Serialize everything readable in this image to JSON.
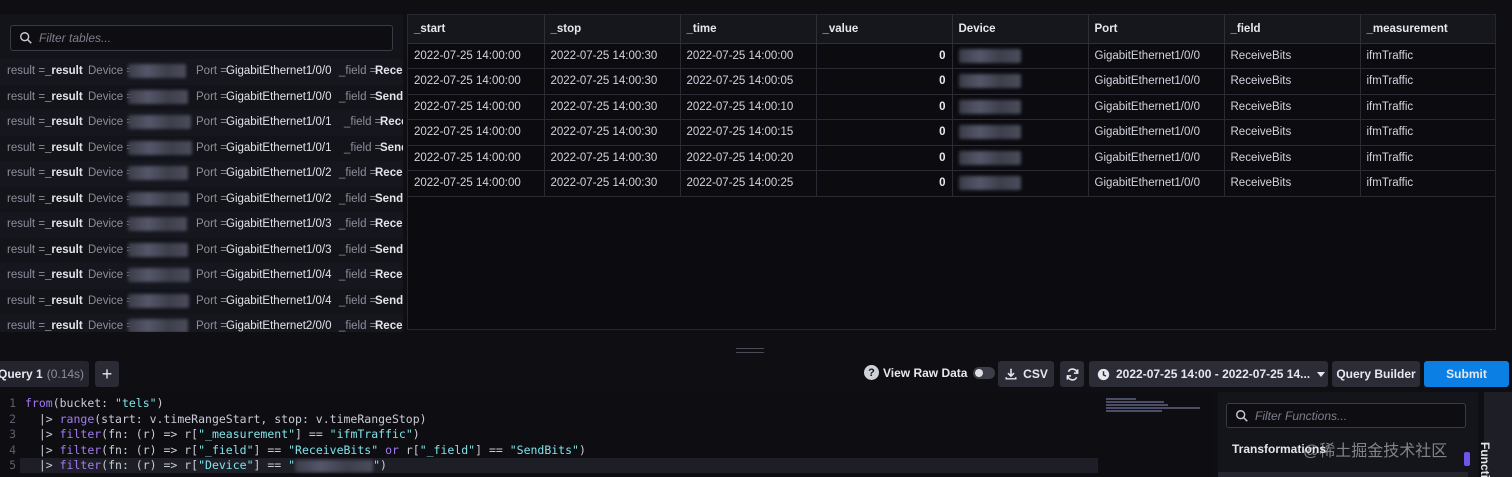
{
  "table_list": {
    "filter_placeholder": "Filter tables...",
    "rows": [
      {
        "result_key": "result =",
        "result_val": "_result",
        "device_key": "Device =",
        "port_key": "Port =",
        "port_val": "GigabitEthernet1/0/0",
        "field_key": "_field =",
        "field_val": "Recei"
      },
      {
        "result_key": "result =",
        "result_val": "_result",
        "device_key": "Device =",
        "port_key": "Port =",
        "port_val": "GigabitEthernet1/0/0",
        "field_key": "_field =",
        "field_val": "SendI"
      },
      {
        "result_key": "result =",
        "result_val": "_result",
        "device_key": "Device =",
        "port_key": "Port =",
        "port_val": "GigabitEthernet1/0/1",
        "field_key": "_field =",
        "field_val": "Recei"
      },
      {
        "result_key": "result =",
        "result_val": "_result",
        "device_key": "Device =",
        "port_key": "Port =",
        "port_val": "GigabitEthernet1/0/1",
        "field_key": "_field =",
        "field_val": "SendI"
      },
      {
        "result_key": "result =",
        "result_val": "_result",
        "device_key": "Device =",
        "port_key": "Port =",
        "port_val": "GigabitEthernet1/0/2",
        "field_key": "_field =",
        "field_val": "Recei"
      },
      {
        "result_key": "result =",
        "result_val": "_result",
        "device_key": "Device =",
        "port_key": "Port =",
        "port_val": "GigabitEthernet1/0/2",
        "field_key": "_field =",
        "field_val": "SendI"
      },
      {
        "result_key": "result =",
        "result_val": "_result",
        "device_key": "Device =",
        "port_key": "Port =",
        "port_val": "GigabitEthernet1/0/3",
        "field_key": "_field =",
        "field_val": "Recei"
      },
      {
        "result_key": "result =",
        "result_val": "_result",
        "device_key": "Device =",
        "port_key": "Port =",
        "port_val": "GigabitEthernet1/0/3",
        "field_key": "_field =",
        "field_val": "SendI"
      },
      {
        "result_key": "result =",
        "result_val": "_result",
        "device_key": "Device =",
        "port_key": "Port =",
        "port_val": "GigabitEthernet1/0/4",
        "field_key": "_field =",
        "field_val": "Recei"
      },
      {
        "result_key": "result =",
        "result_val": "_result",
        "device_key": "Device =",
        "port_key": "Port =",
        "port_val": "GigabitEthernet1/0/4",
        "field_key": "_field =",
        "field_val": "SendI"
      },
      {
        "result_key": "result =",
        "result_val": "_result",
        "device_key": "Device =",
        "port_key": "Port =",
        "port_val": "GigabitEthernet2/0/0",
        "field_key": "_field =",
        "field_val": "Recei"
      }
    ]
  },
  "results": {
    "columns": [
      "_start",
      "_stop",
      "_time",
      "_value",
      "Device",
      "Port",
      "_field",
      "_measurement"
    ],
    "rows": [
      [
        "2022-07-25 14:00:00",
        "2022-07-25 14:00:30",
        "2022-07-25 14:00:00",
        "0",
        "",
        "GigabitEthernet1/0/0",
        "ReceiveBits",
        "ifmTraffic"
      ],
      [
        "2022-07-25 14:00:00",
        "2022-07-25 14:00:30",
        "2022-07-25 14:00:05",
        "0",
        "",
        "GigabitEthernet1/0/0",
        "ReceiveBits",
        "ifmTraffic"
      ],
      [
        "2022-07-25 14:00:00",
        "2022-07-25 14:00:30",
        "2022-07-25 14:00:10",
        "0",
        "",
        "GigabitEthernet1/0/0",
        "ReceiveBits",
        "ifmTraffic"
      ],
      [
        "2022-07-25 14:00:00",
        "2022-07-25 14:00:30",
        "2022-07-25 14:00:15",
        "0",
        "",
        "GigabitEthernet1/0/0",
        "ReceiveBits",
        "ifmTraffic"
      ],
      [
        "2022-07-25 14:00:00",
        "2022-07-25 14:00:30",
        "2022-07-25 14:00:20",
        "0",
        "",
        "GigabitEthernet1/0/0",
        "ReceiveBits",
        "ifmTraffic"
      ],
      [
        "2022-07-25 14:00:00",
        "2022-07-25 14:00:30",
        "2022-07-25 14:00:25",
        "0",
        "",
        "GigabitEthernet1/0/0",
        "ReceiveBits",
        "ifmTraffic"
      ]
    ]
  },
  "toolbar": {
    "query_tab_label": "Query 1",
    "query_tab_duration": "(0.14s)",
    "add_tab_label": "+",
    "help_label": "?",
    "view_raw_label": "View Raw Data",
    "view_raw_enabled": false,
    "csv_label": "CSV",
    "time_range_label": "2022-07-25 14:00 - 2022-07-25 14...",
    "query_builder_label": "Query Builder",
    "submit_label": "Submit"
  },
  "editor": {
    "line_numbers": [
      "1",
      "2",
      "3",
      "4",
      "5"
    ],
    "lines": [
      [
        {
          "t": "from",
          "c": "fn"
        },
        {
          "t": "(bucket: ",
          "c": "op"
        },
        {
          "t": "\"tels\"",
          "c": "str"
        },
        {
          "t": ")",
          "c": "op"
        }
      ],
      [
        {
          "t": "  |> ",
          "c": "op"
        },
        {
          "t": "range",
          "c": "fn"
        },
        {
          "t": "(start: v.timeRangeStart, stop: v.timeRangeStop)",
          "c": "op"
        }
      ],
      [
        {
          "t": "  |> ",
          "c": "op"
        },
        {
          "t": "filter",
          "c": "fn"
        },
        {
          "t": "(fn: (r) => r[",
          "c": "op"
        },
        {
          "t": "\"_measurement\"",
          "c": "str"
        },
        {
          "t": "] == ",
          "c": "op"
        },
        {
          "t": "\"ifmTraffic\"",
          "c": "str"
        },
        {
          "t": ")",
          "c": "op"
        }
      ],
      [
        {
          "t": "  |> ",
          "c": "op"
        },
        {
          "t": "filter",
          "c": "fn"
        },
        {
          "t": "(fn: (r) => r[",
          "c": "op"
        },
        {
          "t": "\"_field\"",
          "c": "str"
        },
        {
          "t": "] == ",
          "c": "op"
        },
        {
          "t": "\"ReceiveBits\"",
          "c": "str"
        },
        {
          "t": " or ",
          "c": "kw"
        },
        {
          "t": "r[",
          "c": "op"
        },
        {
          "t": "\"_field\"",
          "c": "str"
        },
        {
          "t": "] == ",
          "c": "op"
        },
        {
          "t": "\"SendBits\"",
          "c": "str"
        },
        {
          "t": ")",
          "c": "op"
        }
      ],
      [
        {
          "t": "  |> ",
          "c": "op"
        },
        {
          "t": "filter",
          "c": "fn"
        },
        {
          "t": "(fn: (r) => r[",
          "c": "op"
        },
        {
          "t": "\"Device\"",
          "c": "str"
        },
        {
          "t": "] == ",
          "c": "op"
        },
        {
          "t": "\"",
          "c": "str"
        },
        {
          "t": "BLUR",
          "c": "blur"
        },
        {
          "t": "\"",
          "c": "str"
        },
        {
          "t": ")",
          "c": "op"
        }
      ]
    ]
  },
  "functions": {
    "filter_placeholder": "Filter Functions...",
    "section_header": "Transformations",
    "side_tab_label": "Functions"
  },
  "watermark": "@稀土掘金技术社区",
  "colors": {
    "accent": "#0b7fe3",
    "string_literal": "#7fe3ea",
    "function_name": "#a47bf2",
    "background": "#0e0e13"
  }
}
